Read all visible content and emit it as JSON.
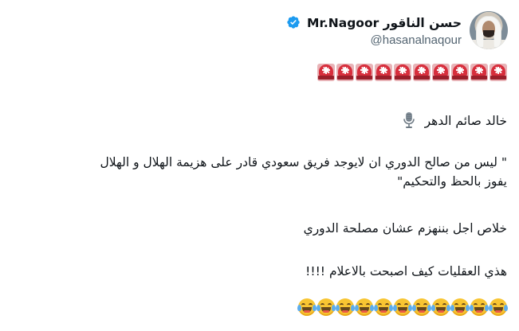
{
  "user": {
    "display_name": "حسن الناقور Mr.Nagoor",
    "handle": "@hasanalnaqour",
    "verified": true,
    "verified_color": "#1d9bf0"
  },
  "tweet": {
    "header_emoji": {
      "name": "police-car-light",
      "count": 10
    },
    "lines": [
      "خالد صائم الدهر",
      "\" ليس من صالح الدوري ان لايوجد فريق سعودي قادر على هزيمة الهلال  و الهلال",
      "يفوز بالحظ والتحكيم\"",
      "خلاص اجل بننهزم عشان مصلحة الدوري",
      "هذي العقليات كيف اصبحت بالاعلام !!!!"
    ],
    "line1_icon": "microphone-icon",
    "footer_emoji": {
      "name": "face-with-tears-of-joy",
      "count": 11
    }
  },
  "colors": {
    "text": "#0f1419",
    "secondary": "#536471",
    "siren_red": "#d72e3c",
    "laugh_yellow": "#f8c532"
  }
}
